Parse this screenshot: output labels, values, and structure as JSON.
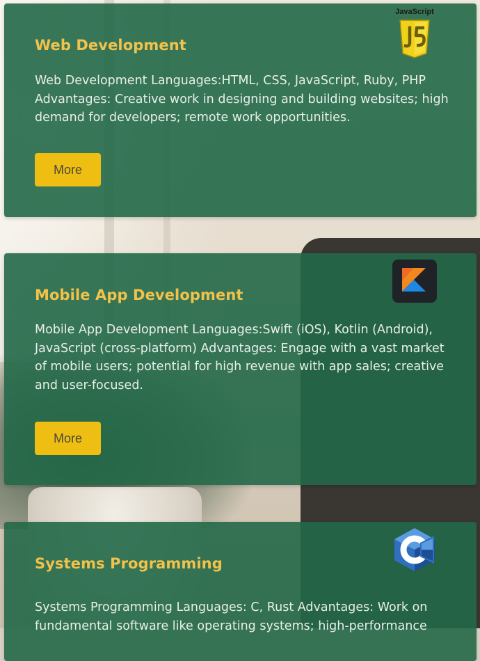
{
  "cards": [
    {
      "id": "web",
      "title": "Web Development",
      "text": "Web Development Languages:HTML, CSS, JavaScript, Ruby, PHP Advantages: Creative work in designing and building websites; high demand for developers; remote work opportunities.",
      "button": "More",
      "logo_icon": "javascript-logo-icon",
      "logo_caption": "JavaScript"
    },
    {
      "id": "mobile",
      "title": "Mobile App Development",
      "text": "Mobile App Development Languages:Swift (iOS), Kotlin (Android), JavaScript (cross-platform) Advantages: Engage with a vast market of mobile users; potential for high revenue with app sales; creative and user-focused.",
      "button": "More",
      "logo_icon": "kotlin-logo-icon"
    },
    {
      "id": "systems",
      "title": "Systems Programming",
      "text": "Systems Programming Languages: C, Rust Advantages: Work on fundamental software like operating systems; high-performance",
      "logo_icon": "c-language-logo-icon"
    }
  ],
  "colors": {
    "card_background": "#226848",
    "title": "#f3c24a",
    "body_text": "#e9efe9",
    "button": "#efbe12",
    "button_text": "#4a4a3a"
  }
}
